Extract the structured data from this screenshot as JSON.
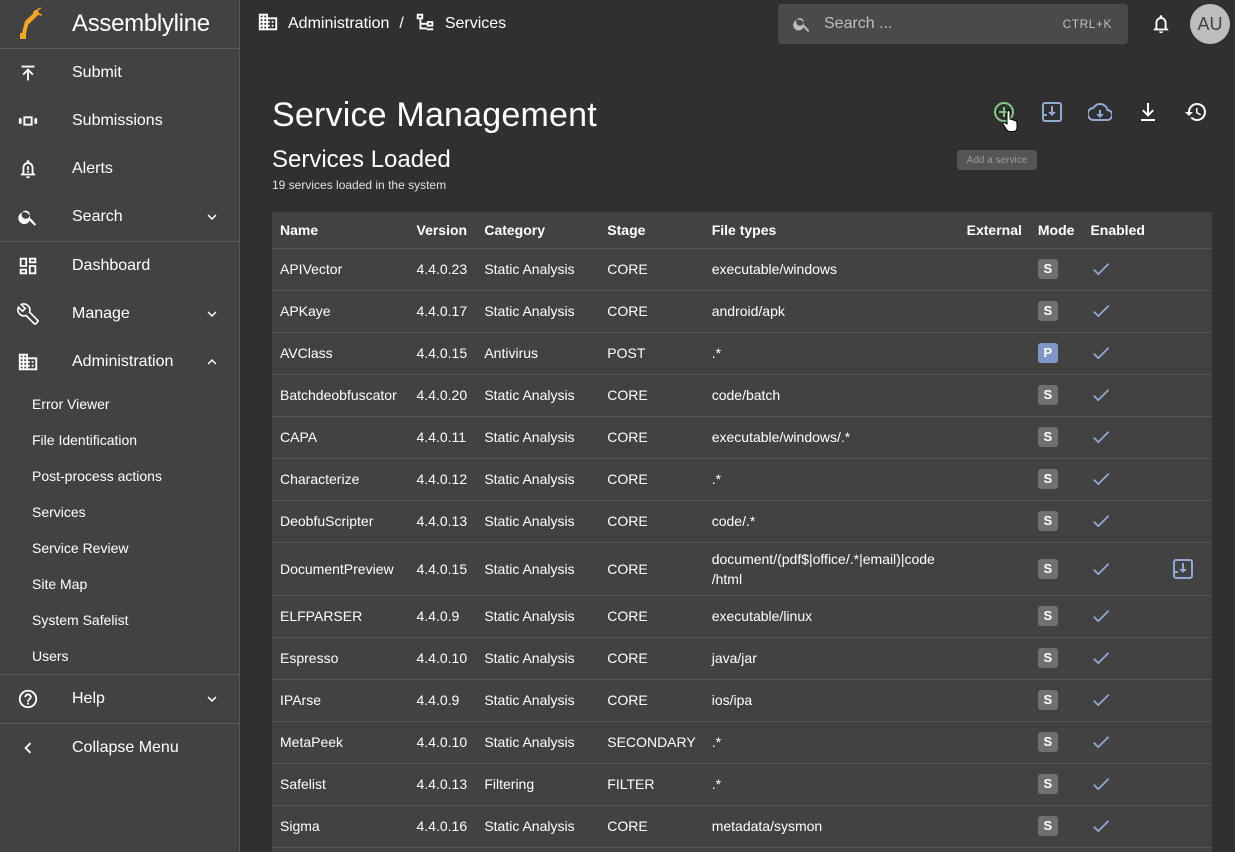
{
  "app": {
    "name": "Assemblyline"
  },
  "sidebar": {
    "items": [
      {
        "label": "Submit",
        "icon": "upload-icon"
      },
      {
        "label": "Submissions",
        "icon": "view-carousel-icon"
      },
      {
        "label": "Alerts",
        "icon": "bell-alert-icon"
      },
      {
        "label": "Search",
        "icon": "search-icon"
      },
      {
        "label": "Dashboard",
        "icon": "dashboard-icon"
      },
      {
        "label": "Manage",
        "icon": "wrench-icon"
      },
      {
        "label": "Administration",
        "icon": "building-icon"
      }
    ],
    "admin_subitems": [
      "Error Viewer",
      "File Identification",
      "Post-process actions",
      "Services",
      "Service Review",
      "Site Map",
      "System Safelist",
      "Users"
    ],
    "help": "Help",
    "collapse": "Collapse Menu"
  },
  "breadcrumb": {
    "first": "Administration",
    "separator": "/",
    "second": "Services"
  },
  "search": {
    "placeholder": "Search ...",
    "shortcut": "CTRL+K"
  },
  "user": {
    "initials": "AU"
  },
  "page": {
    "title": "Service Management",
    "section_title": "Services Loaded",
    "section_subtitle": "19 services loaded in the system",
    "tooltip": "Add a service"
  },
  "colors": {
    "accent": "#8fa8d6",
    "add": "#81c784",
    "badge_s": "#707070",
    "badge_p": "#8095c9"
  },
  "table": {
    "headers": [
      "Name",
      "Version",
      "Category",
      "Stage",
      "File types",
      "External",
      "Mode",
      "Enabled"
    ],
    "rows": [
      {
        "name": "APIVector",
        "version": "4.4.0.23",
        "category": "Static Analysis",
        "stage": "CORE",
        "types": "executable/windows",
        "mode": "S"
      },
      {
        "name": "APKaye",
        "version": "4.4.0.17",
        "category": "Static Analysis",
        "stage": "CORE",
        "types": "android/apk",
        "mode": "S"
      },
      {
        "name": "AVClass",
        "version": "4.4.0.15",
        "category": "Antivirus",
        "stage": "POST",
        "types": ".*",
        "mode": "P"
      },
      {
        "name": "Batchdeobfuscator",
        "version": "4.4.0.20",
        "category": "Static Analysis",
        "stage": "CORE",
        "types": "code/batch",
        "mode": "S"
      },
      {
        "name": "CAPA",
        "version": "4.4.0.11",
        "category": "Static Analysis",
        "stage": "CORE",
        "types": "executable/windows/.*",
        "mode": "S"
      },
      {
        "name": "Characterize",
        "version": "4.4.0.12",
        "category": "Static Analysis",
        "stage": "CORE",
        "types": ".*",
        "mode": "S"
      },
      {
        "name": "DeobfuScripter",
        "version": "4.4.0.13",
        "category": "Static Analysis",
        "stage": "CORE",
        "types": "code/.*",
        "mode": "S"
      },
      {
        "name": "DocumentPreview",
        "version": "4.4.0.15",
        "category": "Static Analysis",
        "stage": "CORE",
        "types": "document/(pdf$|office/.*|email)|code\n/html",
        "mode": "S"
      },
      {
        "name": "ELFPARSER",
        "version": "4.4.0.9",
        "category": "Static Analysis",
        "stage": "CORE",
        "types": "executable/linux",
        "mode": "S"
      },
      {
        "name": "Espresso",
        "version": "4.4.0.10",
        "category": "Static Analysis",
        "stage": "CORE",
        "types": "java/jar",
        "mode": "S"
      },
      {
        "name": "IPArse",
        "version": "4.4.0.9",
        "category": "Static Analysis",
        "stage": "CORE",
        "types": "ios/ipa",
        "mode": "S"
      },
      {
        "name": "MetaPeek",
        "version": "4.4.0.10",
        "category": "Static Analysis",
        "stage": "SECONDARY",
        "types": ".*",
        "mode": "S"
      },
      {
        "name": "Safelist",
        "version": "4.4.0.13",
        "category": "Filtering",
        "stage": "FILTER",
        "types": ".*",
        "mode": "S"
      },
      {
        "name": "Sigma",
        "version": "4.4.0.16",
        "category": "Static Analysis",
        "stage": "CORE",
        "types": "metadata/sysmon",
        "mode": "S"
      }
    ]
  }
}
